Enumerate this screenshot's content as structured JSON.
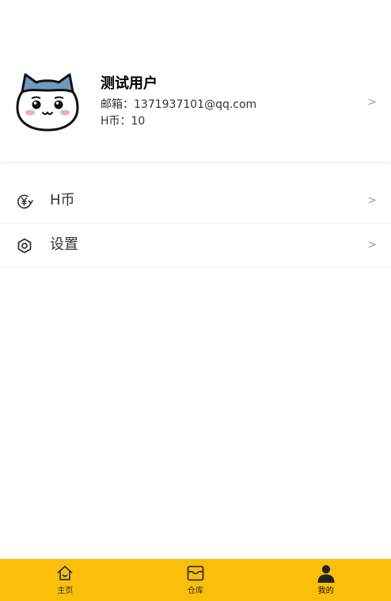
{
  "profile": {
    "username": "测试用户",
    "email_line": "邮箱：1371937101@qq.com",
    "coins_line": "H币：10",
    "chevron": ">",
    "avatar_icon": "cat-avatar-icon"
  },
  "menu": {
    "items": [
      {
        "label": "H币",
        "icon": "coin-exchange-icon",
        "chevron": ">"
      },
      {
        "label": "设置",
        "icon": "settings-hexagon-icon",
        "chevron": ">"
      }
    ]
  },
  "tabbar": {
    "background": "#fbbf0a",
    "tabs": [
      {
        "label": "主页",
        "icon": "home-icon",
        "active": false
      },
      {
        "label": "仓库",
        "icon": "inbox-icon",
        "active": false
      },
      {
        "label": "我的",
        "icon": "user-icon",
        "active": true
      }
    ]
  }
}
